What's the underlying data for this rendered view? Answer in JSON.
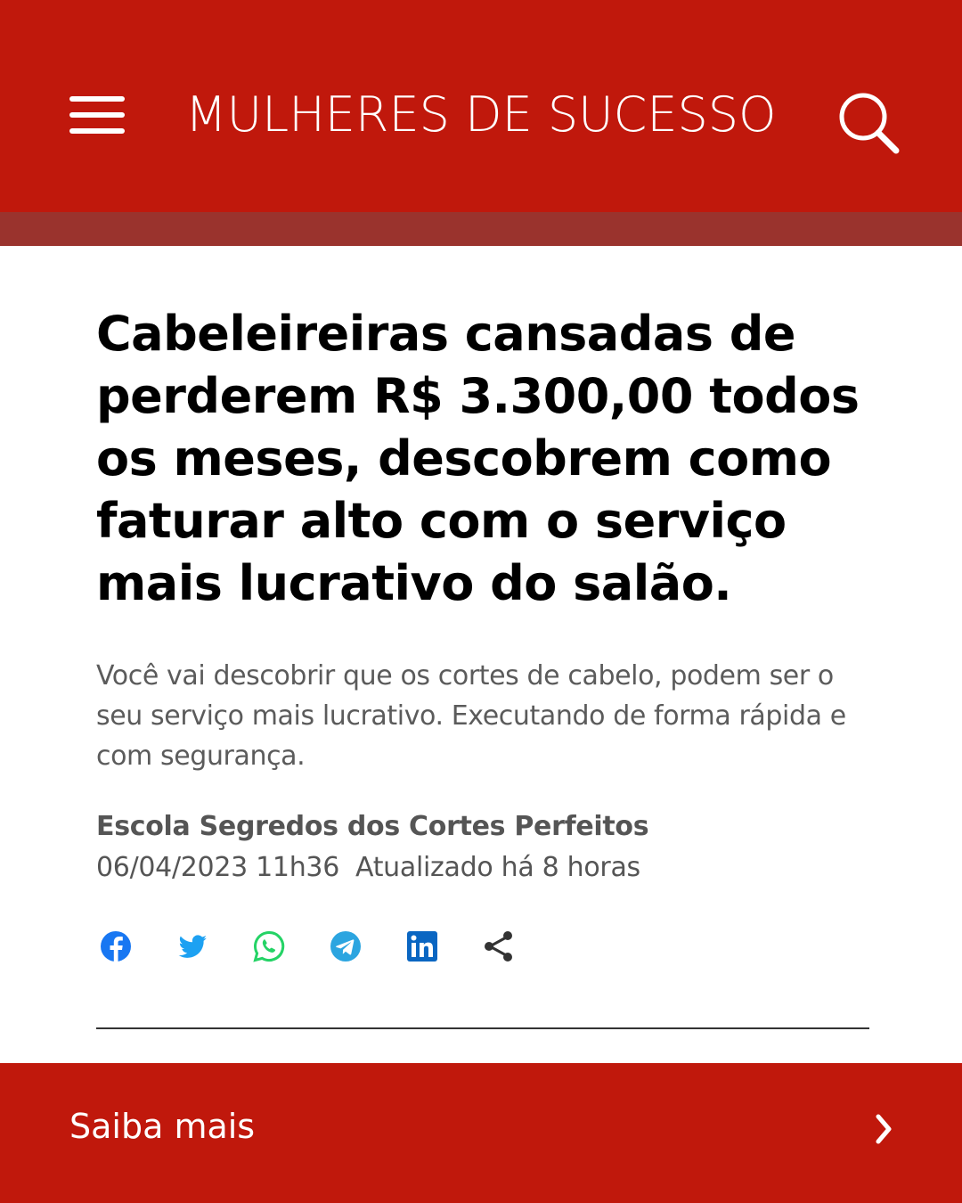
{
  "header": {
    "site_title": "MULHERES DE SUCESSO",
    "menu_icon": "hamburger-menu-icon",
    "search_icon": "search-icon",
    "background_color": "#c0180c",
    "stripe_color": "#9a332d"
  },
  "article": {
    "headline": "Cabeleireiras cansadas de perderem R$ 3.300,00 todos os meses, descobrem como faturar alto com o serviço mais lucrativo do salão.",
    "lead": "Você vai descobrir que os cortes de cabelo, podem ser o seu serviço mais lucrativo. Executando de forma rápida e com segurança.",
    "author": "Escola Segredos dos Cortes Perfeitos",
    "date": "06/04/2023 11h36",
    "updated": "Atualizado há 8 horas"
  },
  "share": {
    "icons": [
      "facebook-icon",
      "twitter-icon",
      "whatsapp-icon",
      "telegram-icon",
      "linkedin-icon",
      "share-icon"
    ],
    "colors": {
      "facebook": "#1877f2",
      "twitter": "#1da1f2",
      "whatsapp": "#25d366",
      "telegram": "#2ca5e0",
      "linkedin": "#0a66c2",
      "share": "#333333"
    }
  },
  "footer": {
    "label": "Saiba mais",
    "icon": "chevron-right-icon",
    "background_color": "#c0180c"
  }
}
